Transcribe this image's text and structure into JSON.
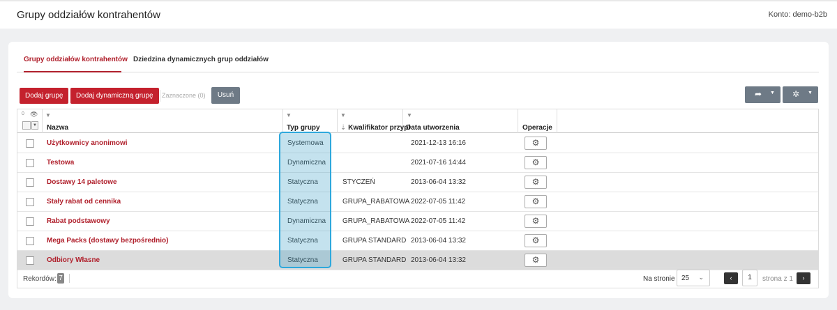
{
  "header": {
    "title": "Grupy oddziałów kontrahentów",
    "account": "Konto: demo-b2b"
  },
  "tabs": [
    {
      "label": "Grupy oddziałów kontrahentów",
      "active": true
    },
    {
      "label": "Dziedzina dynamicznych grup oddziałów",
      "active": false
    }
  ],
  "toolbar": {
    "add_label": "Dodaj grupę",
    "add_dynamic_label": "Dodaj dynamiczną grupę",
    "selected_label": "Zaznaczone (0)",
    "delete_label": "Usuń",
    "export_icon": "export-icon",
    "tools_icon": "tools-icon"
  },
  "table": {
    "selected_count": "0",
    "columns": {
      "name": "Nazwa",
      "type": "Typ grupy",
      "qualifier": "Kwalifikator przypi",
      "date": "Data utworzenia",
      "ops": "Operacje"
    },
    "rows": [
      {
        "name": "Użytkownicy anonimowi",
        "type": "Systemowa",
        "qualifier": "",
        "date": "2021-12-13 16:16"
      },
      {
        "name": "Testowa",
        "type": "Dynamiczna",
        "qualifier": "",
        "date": "2021-07-16 14:44"
      },
      {
        "name": "Dostawy 14 paletowe",
        "type": "Statyczna",
        "qualifier": "STYCZEŃ",
        "date": "2013-06-04 13:32"
      },
      {
        "name": "Stały rabat od cennika",
        "type": "Statyczna",
        "qualifier": "GRUPA_RABATOWA",
        "date": "2022-07-05 11:42"
      },
      {
        "name": "Rabat podstawowy",
        "type": "Dynamiczna",
        "qualifier": "GRUPA_RABATOWA",
        "date": "2022-07-05 11:42"
      },
      {
        "name": "Mega Packs (dostawy bezpośrednio)",
        "type": "Statyczna",
        "qualifier": "GRUPA STANDARD",
        "date": "2013-06-04 13:32"
      },
      {
        "name": "Odbiory Własne",
        "type": "Statyczna",
        "qualifier": "GRUPA STANDARD",
        "date": "2013-06-04 13:32",
        "highlighted": true
      }
    ]
  },
  "footer": {
    "records_label": "Rekordów:",
    "records_count": "7",
    "per_page_label": "Na stronie",
    "per_page_value": "25",
    "page": "1",
    "page_of": "strona z 1"
  },
  "colors": {
    "accent": "#c4212d",
    "highlight_border": "#2ea8dc",
    "secondary_button": "#6e7a86"
  }
}
